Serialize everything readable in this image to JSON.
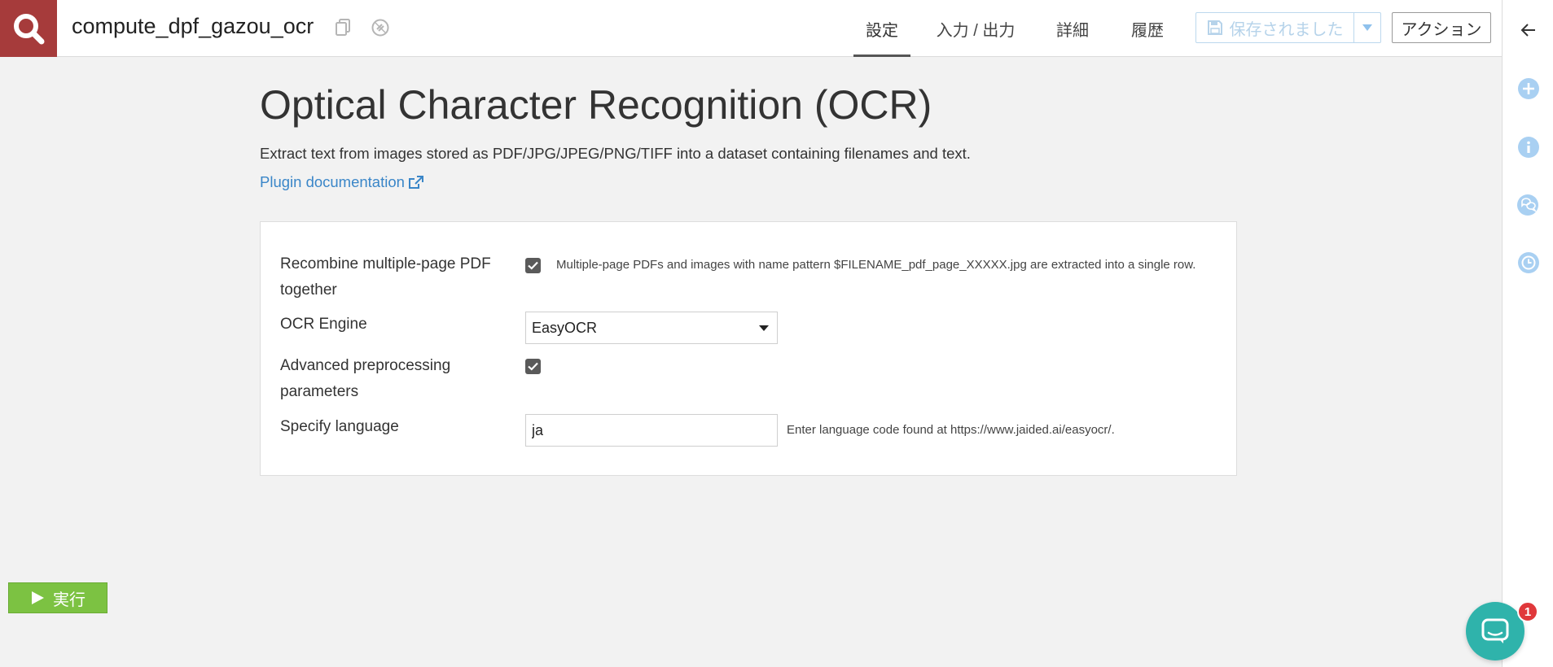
{
  "header": {
    "recipe_name": "compute_dpf_gazou_ocr",
    "tabs": [
      {
        "label": "設定",
        "active": true
      },
      {
        "label": "入力 / 出力",
        "active": false
      },
      {
        "label": "詳細",
        "active": false
      },
      {
        "label": "履歴",
        "active": false
      }
    ],
    "save_label": "保存されました",
    "action_label": "アクション"
  },
  "main": {
    "title": "Optical Character Recognition (OCR)",
    "description": "Extract text from images stored as PDF/JPG/JPEG/PNG/TIFF into a dataset containing filenames and text.",
    "doc_link": "Plugin documentation",
    "fields": {
      "recombine": {
        "label": "Recombine multiple-page PDF together",
        "checked": true,
        "help": "Multiple-page PDFs and images with name pattern $FILENAME_pdf_page_XXXXX.jpg are extracted into a single row."
      },
      "engine": {
        "label": "OCR Engine",
        "value": "EasyOCR"
      },
      "advanced": {
        "label": "Advanced preprocessing parameters",
        "checked": true
      },
      "language": {
        "label": "Specify language",
        "value": "ja",
        "help": "Enter language code found at https://www.jaided.ai/easyocr/."
      }
    }
  },
  "footer": {
    "run_label": "実行",
    "chat_badge_count": "1"
  },
  "colors": {
    "logo_bg": "#a63b3b",
    "accent_link": "#3a86c8",
    "run_green": "#7cc242",
    "chat_teal": "#2fb3ab",
    "rail_icon_blue": "#8fc1ec",
    "badge_red": "#e0383b"
  },
  "icons": {
    "logo": "search-icon",
    "copy": "copy-icon",
    "link": "link-icon",
    "save": "floppy-disk-icon",
    "caret": "caret-down-icon",
    "back": "arrow-left-icon",
    "add": "plus-circle-icon",
    "info": "info-circle-icon",
    "discussions": "chat-bubbles-icon",
    "history": "clock-icon",
    "external": "external-link-icon",
    "run": "play-icon",
    "chat": "chat-icon"
  }
}
